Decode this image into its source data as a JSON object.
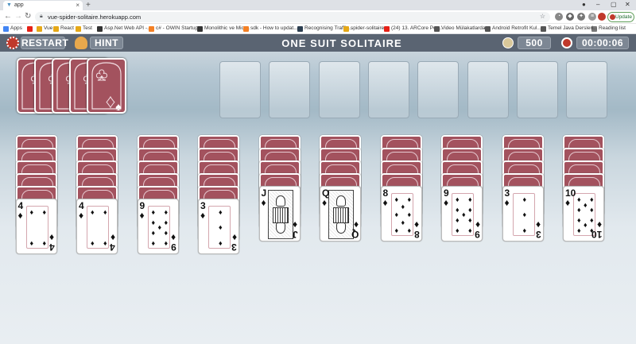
{
  "browser": {
    "tab_title": "app",
    "new_tab": "+",
    "url": "vue-spider-solitaire.herokuapp.com",
    "update_label": "Update",
    "reading_list": "Reading list",
    "window_controls": [
      "–",
      "▢",
      "✕"
    ]
  },
  "bookmarks": [
    {
      "label": "Apps",
      "color": "#4285f4"
    },
    {
      "label": "",
      "color": "#e62117"
    },
    {
      "label": "Vue",
      "color": "#e6a817"
    },
    {
      "label": "React",
      "color": "#e6a817"
    },
    {
      "label": "Test",
      "color": "#e6a817"
    },
    {
      "label": "Asp.Net Web API -...",
      "color": "#333333"
    },
    {
      "label": "c# - OWIN Startup...",
      "color": "#f48024"
    },
    {
      "label": "Monolithic ve Micr...",
      "color": "#333333"
    },
    {
      "label": "sdk - How to updat...",
      "color": "#f48024"
    },
    {
      "label": "Recognising Traffic...",
      "color": "#2c3e50"
    },
    {
      "label": "spider-solitaire",
      "color": "#e6a817"
    },
    {
      "label": "(24) 13. ARCore Por...",
      "color": "#e62117"
    },
    {
      "label": "Video Mülakatlarda...",
      "color": "#555555"
    },
    {
      "label": "Android Retrofit Kul...",
      "color": "#555555"
    },
    {
      "label": "Temel Java Dersleri...",
      "color": "#555555"
    }
  ],
  "game": {
    "restart_label": "RESTART",
    "hint_label": "HINT",
    "title": "ONE SUIT SOLITAIRE",
    "score": "500",
    "timer": "00:00:06",
    "header_color": "#5a6472",
    "card_back_color": "#a3525e"
  },
  "stock": {
    "suit": "♣",
    "remaining_decks": 5
  },
  "foundations": 8,
  "tableau": [
    {
      "hidden": 5,
      "rank": "4",
      "suit": "♦"
    },
    {
      "hidden": 5,
      "rank": "4",
      "suit": "♦"
    },
    {
      "hidden": 5,
      "rank": "9",
      "suit": "♦"
    },
    {
      "hidden": 5,
      "rank": "3",
      "suit": "♦"
    },
    {
      "hidden": 4,
      "rank": "J",
      "suit": "♦"
    },
    {
      "hidden": 4,
      "rank": "Q",
      "suit": "♦"
    },
    {
      "hidden": 4,
      "rank": "8",
      "suit": "♦"
    },
    {
      "hidden": 4,
      "rank": "9",
      "suit": "♦"
    },
    {
      "hidden": 4,
      "rank": "3",
      "suit": "♦"
    },
    {
      "hidden": 4,
      "rank": "10",
      "suit": "♦"
    }
  ]
}
